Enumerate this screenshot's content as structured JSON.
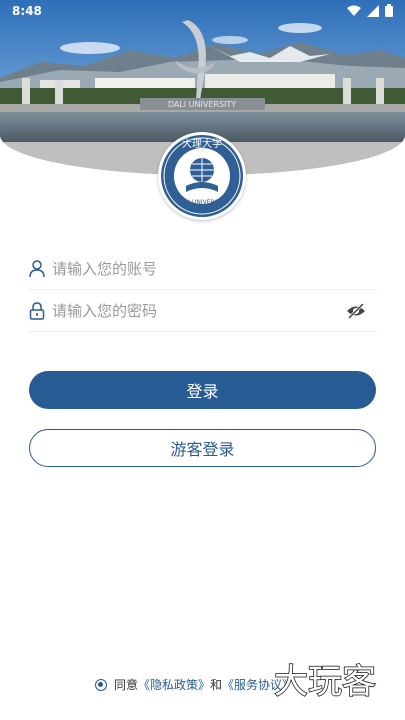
{
  "status_bar": {
    "time": "8:48"
  },
  "header": {
    "campus_sign": "DALI UNIVERSITY",
    "logo": {
      "name_cn": "大理大学",
      "name_en": "DALI UNIVERSITY"
    }
  },
  "login_form": {
    "account_placeholder": "请输入您的账号",
    "password_placeholder": "请输入您的密码",
    "login_button": "登录",
    "guest_button": "游客登录"
  },
  "agreement": {
    "prefix": "同意",
    "privacy_link": "《隐私政策》",
    "conjunction": "和",
    "service_link": "《服务协议》"
  },
  "watermark": "大玩客",
  "colors": {
    "primary": "#285b93",
    "placeholder": "#9a9a9a",
    "divider": "#f0f0f0"
  },
  "icons": [
    "person-icon",
    "lock-icon",
    "eye-off-icon",
    "wifi-icon",
    "signal-icon",
    "battery-icon"
  ]
}
